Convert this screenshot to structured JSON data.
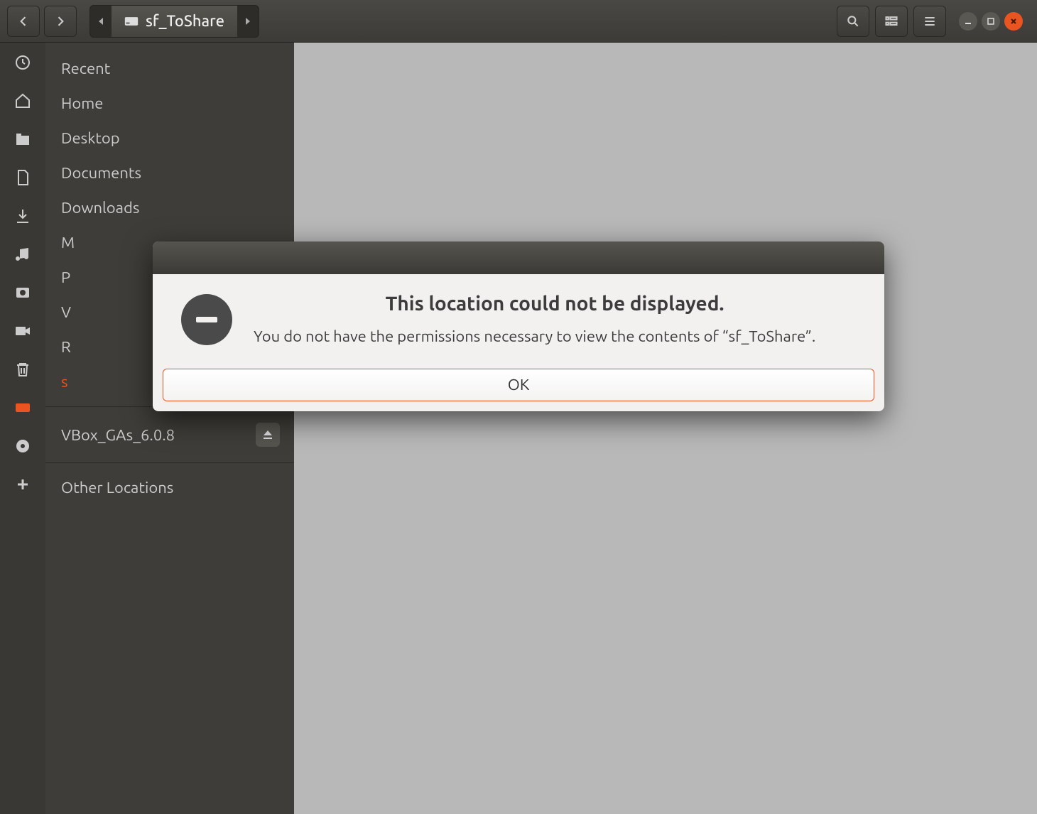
{
  "breadcrumb": {
    "current": "sf_ToShare"
  },
  "sidebar": {
    "items": [
      {
        "label": "Recent"
      },
      {
        "label": "Home"
      },
      {
        "label": "Desktop"
      },
      {
        "label": "Documents"
      },
      {
        "label": "Downloads"
      },
      {
        "label": "M"
      },
      {
        "label": "P"
      },
      {
        "label": "V"
      },
      {
        "label": "R"
      },
      {
        "label": "s"
      }
    ],
    "mount": {
      "label": "VBox_GAs_6.0.8"
    },
    "other": {
      "label": "Other Locations"
    }
  },
  "dialog": {
    "title": "This location could not be displayed.",
    "message": "You do not have the permissions necessary to view the contents of “sf_ToShare”.",
    "ok_label": "OK"
  }
}
